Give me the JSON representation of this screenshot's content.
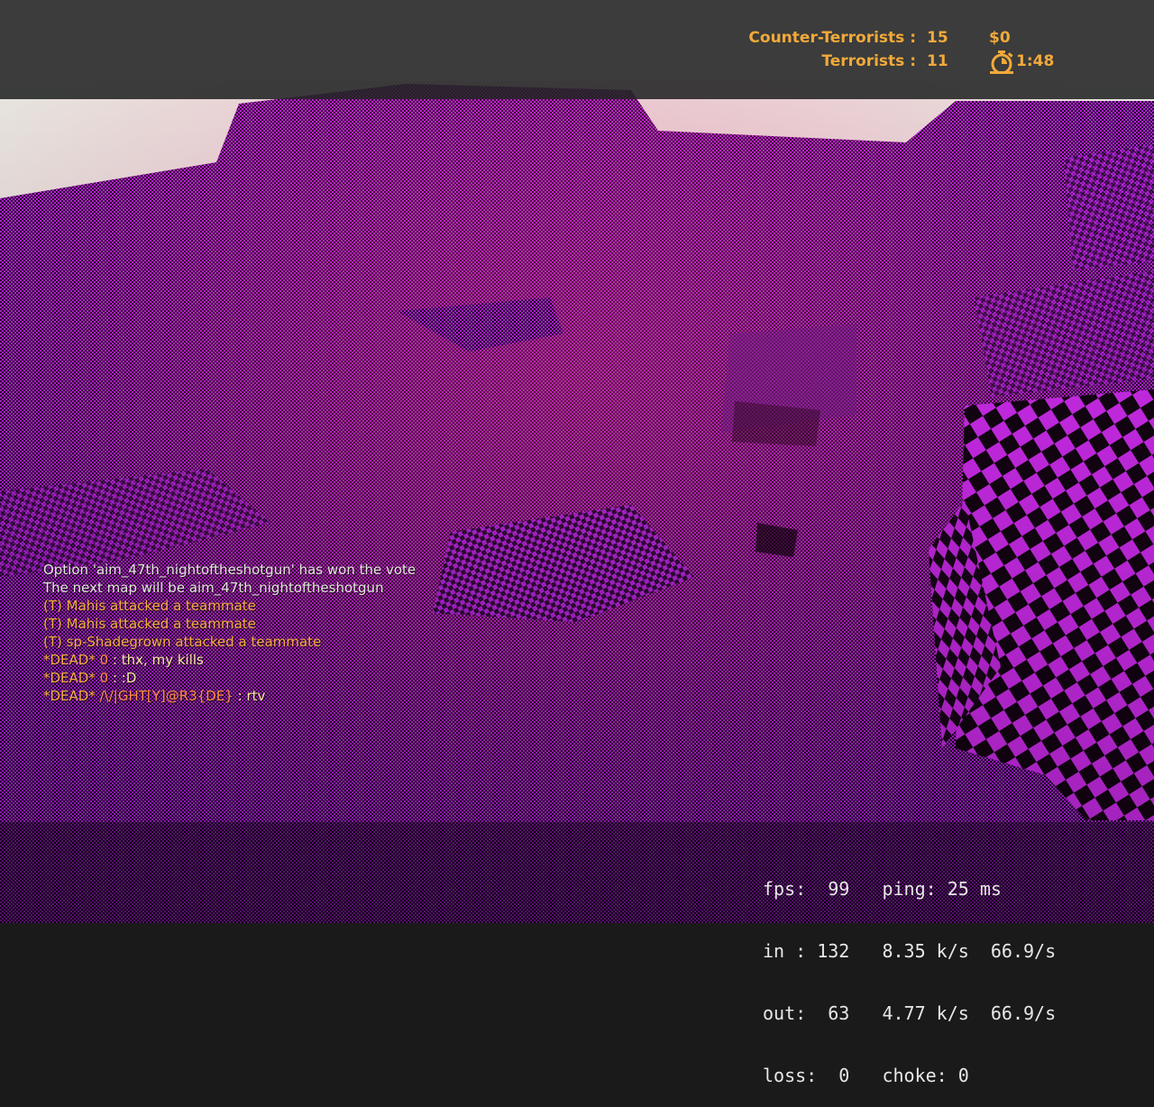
{
  "scoreboard": {
    "ct_label": "Counter-Terrorists :",
    "ct_score": "15",
    "t_label": "Terrorists :",
    "t_score": "11",
    "money": "$0",
    "round_timer": "1:48",
    "hud_color": "#f2a93b"
  },
  "chat": [
    {
      "type": "sys",
      "text": "Option 'aim_47th_nightoftheshotgun' has won the vote"
    },
    {
      "type": "sys",
      "text": "The next map will be aim_47th_nightoftheshotgun"
    },
    {
      "type": "team",
      "text": "(T) Mahis attacked a teammate"
    },
    {
      "type": "team",
      "text": "(T) Mahis attacked a teammate"
    },
    {
      "type": "team",
      "text": "(T) sp-Shadegrown attacked a teammate"
    },
    {
      "type": "dead",
      "tag": "*DEAD*",
      "name": "0",
      "sep": " :",
      "msg": "thx, my kills"
    },
    {
      "type": "dead",
      "tag": "*DEAD*",
      "name": "0",
      "sep": " :",
      "msg": ":D"
    },
    {
      "type": "dead",
      "tag": "*DEAD*",
      "name": "/\\/|GHT[Y]@R3{DE}",
      "sep": " :",
      "msg": "rtv"
    }
  ],
  "net_graph": {
    "row1": "fps:  99   ping: 25 ms",
    "row2": "in : 132   8.35 k/s  66.9/s",
    "row3": "out:  63   4.77 k/s  66.9/s",
    "row4": "loss:  0   choke: 0"
  },
  "scene": {
    "texture_color_a": "#b81ee6",
    "texture_color_b": "#1a0622",
    "sky_color": "#e9e6e0"
  }
}
